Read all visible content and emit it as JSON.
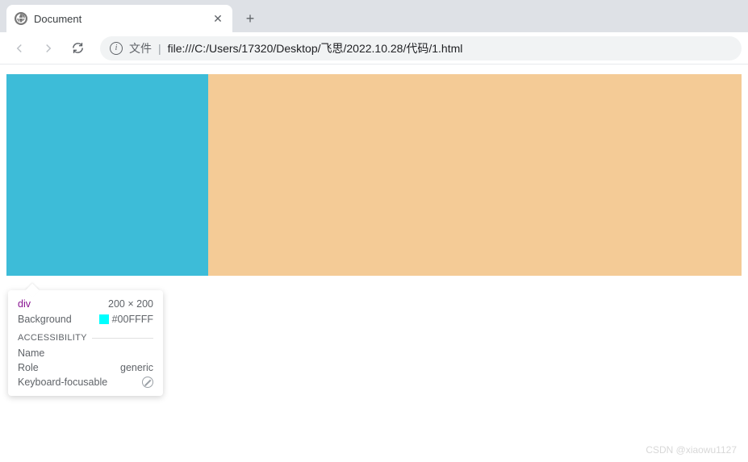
{
  "browser": {
    "tab": {
      "title": "Document"
    },
    "address": {
      "prefix": "文件",
      "url": "file:///C:/Users/17320/Desktop/飞思/2022.10.28/代码/1.html"
    }
  },
  "page": {
    "boxes": {
      "left_color": "#3dbcd8",
      "right_color": "#f4cb96"
    }
  },
  "tooltip": {
    "tag": "div",
    "dimensions": "200 × 200",
    "bg_label": "Background",
    "bg_value": "#00FFFF",
    "section": "Accessibility",
    "name_label": "Name",
    "name_value": "",
    "role_label": "Role",
    "role_value": "generic",
    "kf_label": "Keyboard-focusable"
  },
  "watermark": "CSDN @xiaowu1127"
}
